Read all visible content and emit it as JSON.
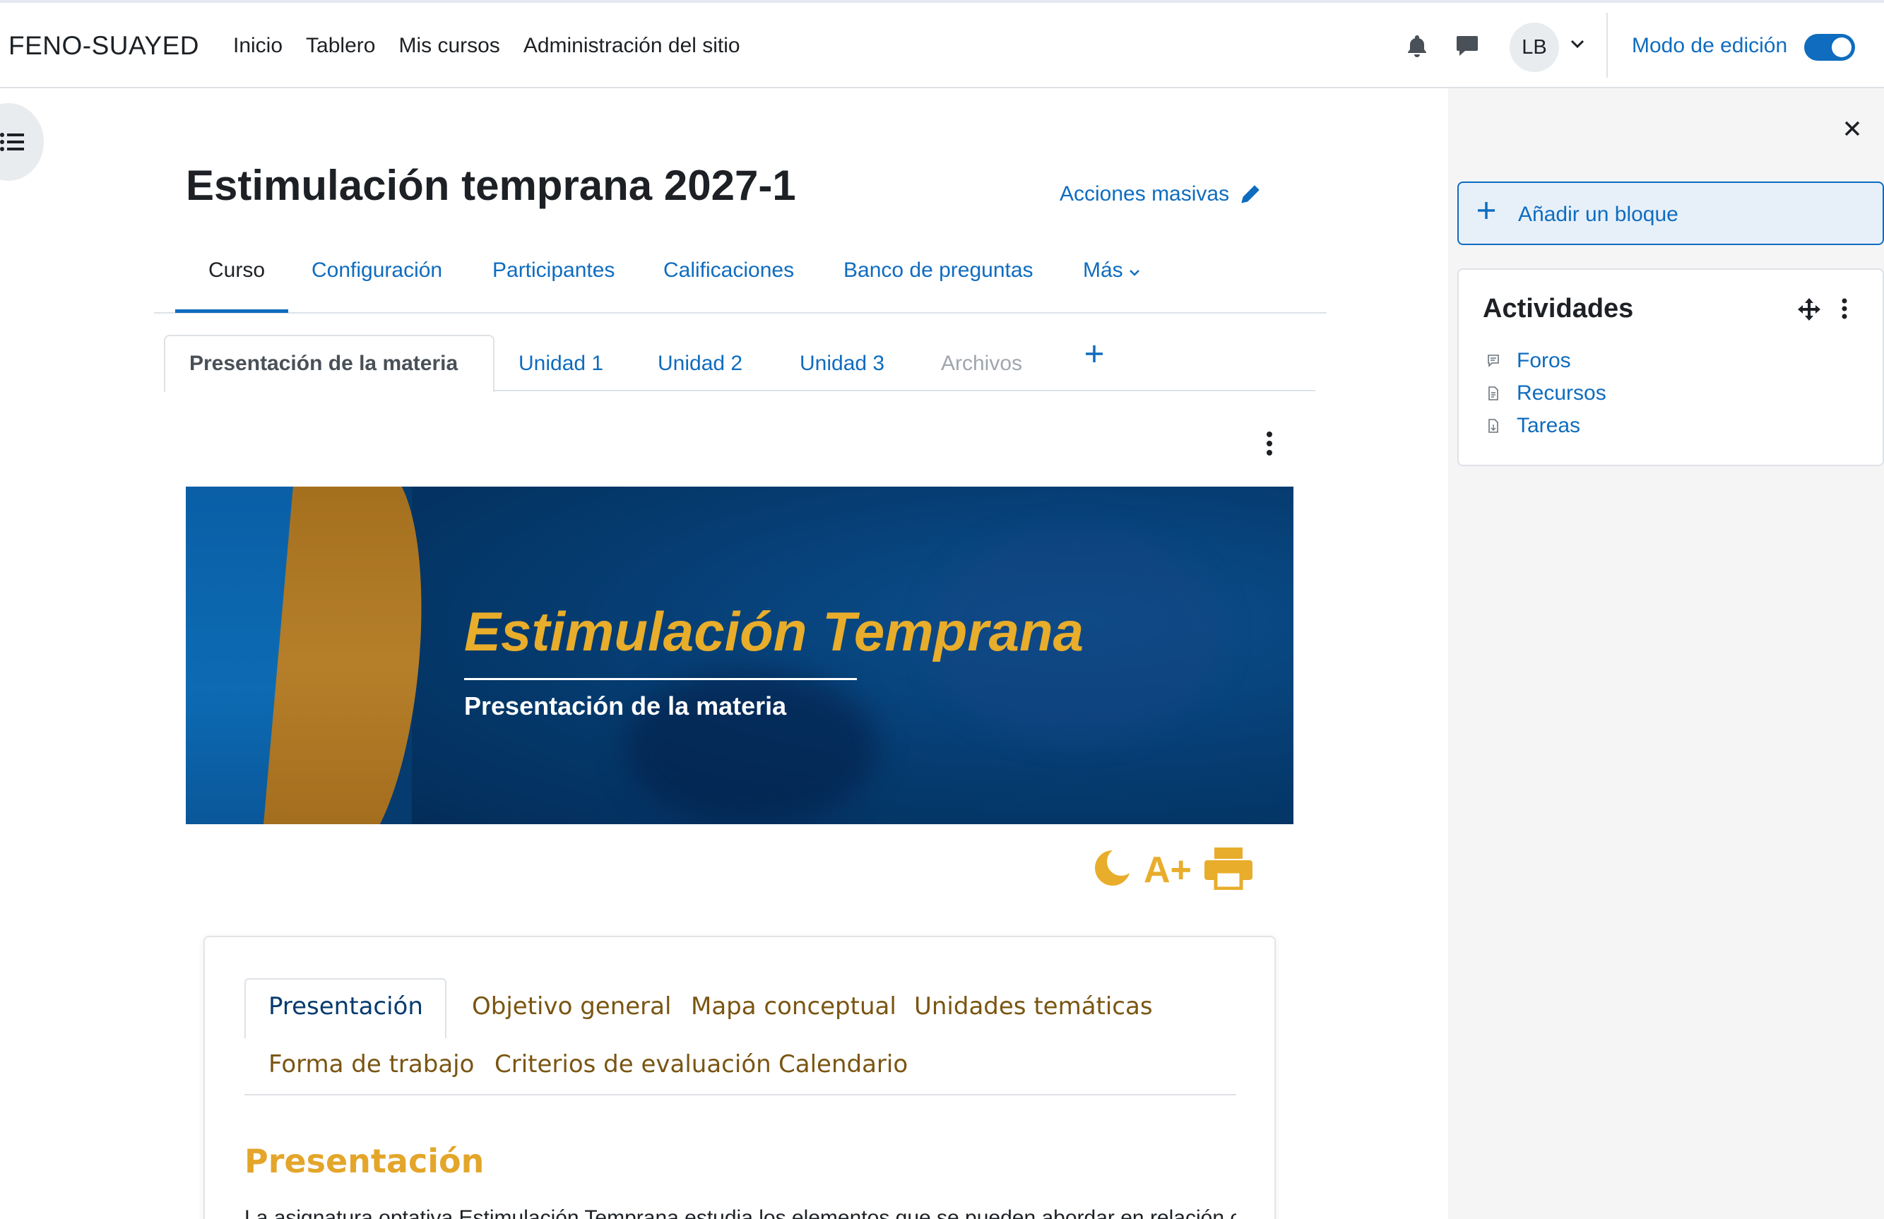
{
  "navbar": {
    "brand": "FENO-SUAYED",
    "links": [
      "Inicio",
      "Tablero",
      "Mis cursos",
      "Administración del sitio"
    ],
    "user_initials": "LB",
    "edit_mode_label": "Modo de edición",
    "edit_mode_on": true
  },
  "course": {
    "title": "Estimulación temprana 2027-1",
    "bulk_actions": "Acciones masivas",
    "secondary_nav": [
      {
        "label": "Curso",
        "active": true
      },
      {
        "label": "Configuración"
      },
      {
        "label": "Participantes"
      },
      {
        "label": "Calificaciones"
      },
      {
        "label": "Banco de preguntas"
      },
      {
        "label": "Más"
      }
    ],
    "unit_tabs": [
      {
        "label": "Presentación de la materia",
        "active": true
      },
      {
        "label": "Unidad 1"
      },
      {
        "label": "Unidad 2"
      },
      {
        "label": "Unidad 3"
      },
      {
        "label": "Archivos",
        "disabled": true
      }
    ]
  },
  "banner": {
    "title": "Estimulación Temprana",
    "subtitle": "Presentación de la materia"
  },
  "tools": {
    "font_increase": "A+"
  },
  "content": {
    "tabs": [
      {
        "label": "Presentación",
        "active": true
      },
      {
        "label": "Objetivo general"
      },
      {
        "label": "Mapa conceptual"
      },
      {
        "label": "Unidades temáticas"
      },
      {
        "label": "Forma de trabajo"
      },
      {
        "label": "Criterios de evaluación"
      },
      {
        "label": "Calendario"
      }
    ],
    "heading": "Presentación",
    "text": "La asignatura optativa Estimulación Temprana estudia los elementos que se pueden abordar en relación con"
  },
  "drawer": {
    "add_block": "Añadir un bloque",
    "block_title": "Actividades",
    "activities": [
      "Foros",
      "Recursos",
      "Tareas"
    ]
  },
  "colors": {
    "primary": "#0f6cbf",
    "banner_navy": "#053b6f",
    "gold": "#e8ad2b",
    "tab_brown": "#7a5512"
  }
}
